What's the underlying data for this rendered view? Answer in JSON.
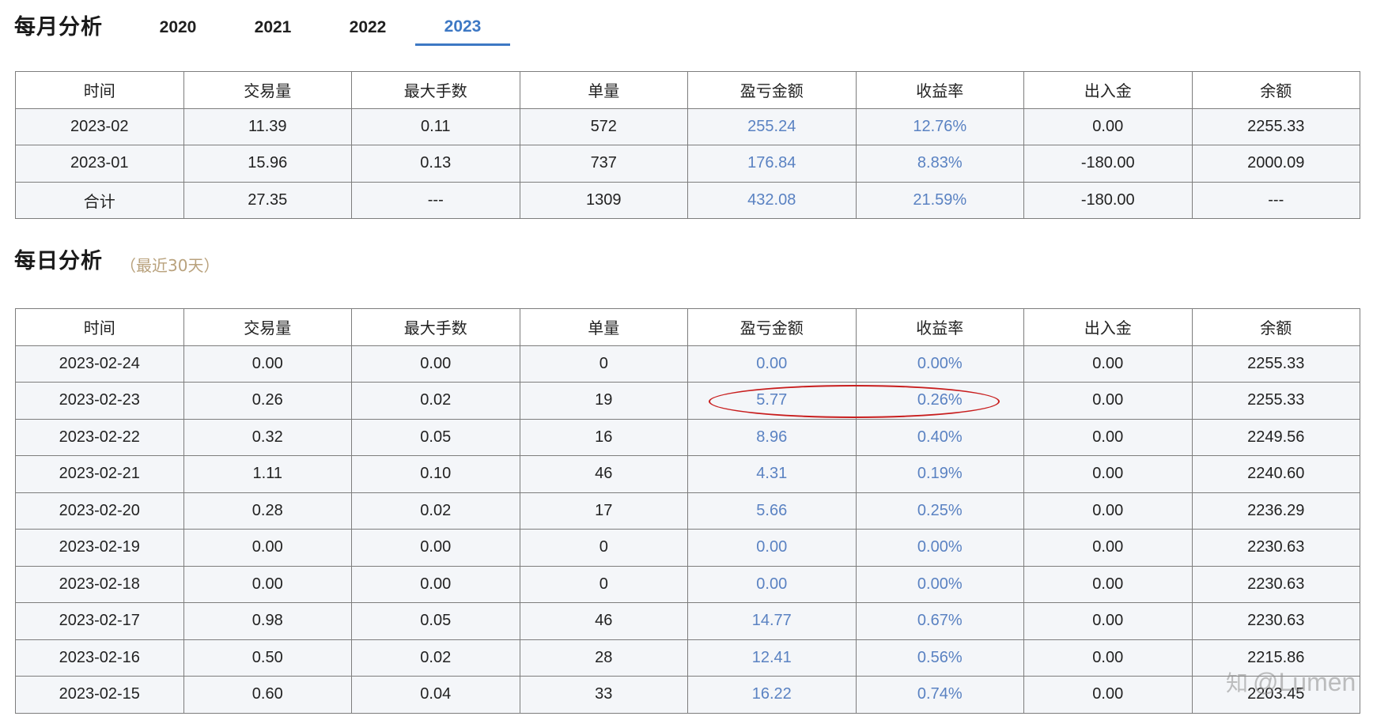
{
  "monthly": {
    "title": "每月分析",
    "tabs": [
      "2020",
      "2021",
      "2022",
      "2023"
    ],
    "active_tab": "2023",
    "headers": [
      "时间",
      "交易量",
      "最大手数",
      "单量",
      "盈亏金额",
      "收益率",
      "出入金",
      "余额"
    ],
    "rows": [
      [
        "2023-02",
        "11.39",
        "0.11",
        "572",
        "255.24",
        "12.76%",
        "0.00",
        "2255.33"
      ],
      [
        "2023-01",
        "15.96",
        "0.13",
        "737",
        "176.84",
        "8.83%",
        "-180.00",
        "2000.09"
      ],
      [
        "合计",
        "27.35",
        "---",
        "1309",
        "432.08",
        "21.59%",
        "-180.00",
        "---"
      ]
    ]
  },
  "daily": {
    "title": "每日分析",
    "subtitle": "（最近30天）",
    "headers": [
      "时间",
      "交易量",
      "最大手数",
      "单量",
      "盈亏金额",
      "收益率",
      "出入金",
      "余额"
    ],
    "rows": [
      [
        "2023-02-24",
        "0.00",
        "0.00",
        "0",
        "0.00",
        "0.00%",
        "0.00",
        "2255.33"
      ],
      [
        "2023-02-23",
        "0.26",
        "0.02",
        "19",
        "5.77",
        "0.26%",
        "0.00",
        "2255.33"
      ],
      [
        "2023-02-22",
        "0.32",
        "0.05",
        "16",
        "8.96",
        "0.40%",
        "0.00",
        "2249.56"
      ],
      [
        "2023-02-21",
        "1.11",
        "0.10",
        "46",
        "4.31",
        "0.19%",
        "0.00",
        "2240.60"
      ],
      [
        "2023-02-20",
        "0.28",
        "0.02",
        "17",
        "5.66",
        "0.25%",
        "0.00",
        "2236.29"
      ],
      [
        "2023-02-19",
        "0.00",
        "0.00",
        "0",
        "0.00",
        "0.00%",
        "0.00",
        "2230.63"
      ],
      [
        "2023-02-18",
        "0.00",
        "0.00",
        "0",
        "0.00",
        "0.00%",
        "0.00",
        "2230.63"
      ],
      [
        "2023-02-17",
        "0.98",
        "0.05",
        "46",
        "14.77",
        "0.67%",
        "0.00",
        "2230.63"
      ],
      [
        "2023-02-16",
        "0.50",
        "0.02",
        "28",
        "12.41",
        "0.56%",
        "0.00",
        "2215.86"
      ],
      [
        "2023-02-15",
        "0.60",
        "0.04",
        "33",
        "16.22",
        "0.74%",
        "0.00",
        "2203.45"
      ]
    ]
  },
  "colors": {
    "accent": "#3d78c4",
    "value_blue": "#5a82c2",
    "annotation_red": "#c81e1e",
    "subtitle_tan": "#b9a27d"
  },
  "watermark": {
    "icon": "zhihu-icon",
    "text": "@Lumen"
  }
}
